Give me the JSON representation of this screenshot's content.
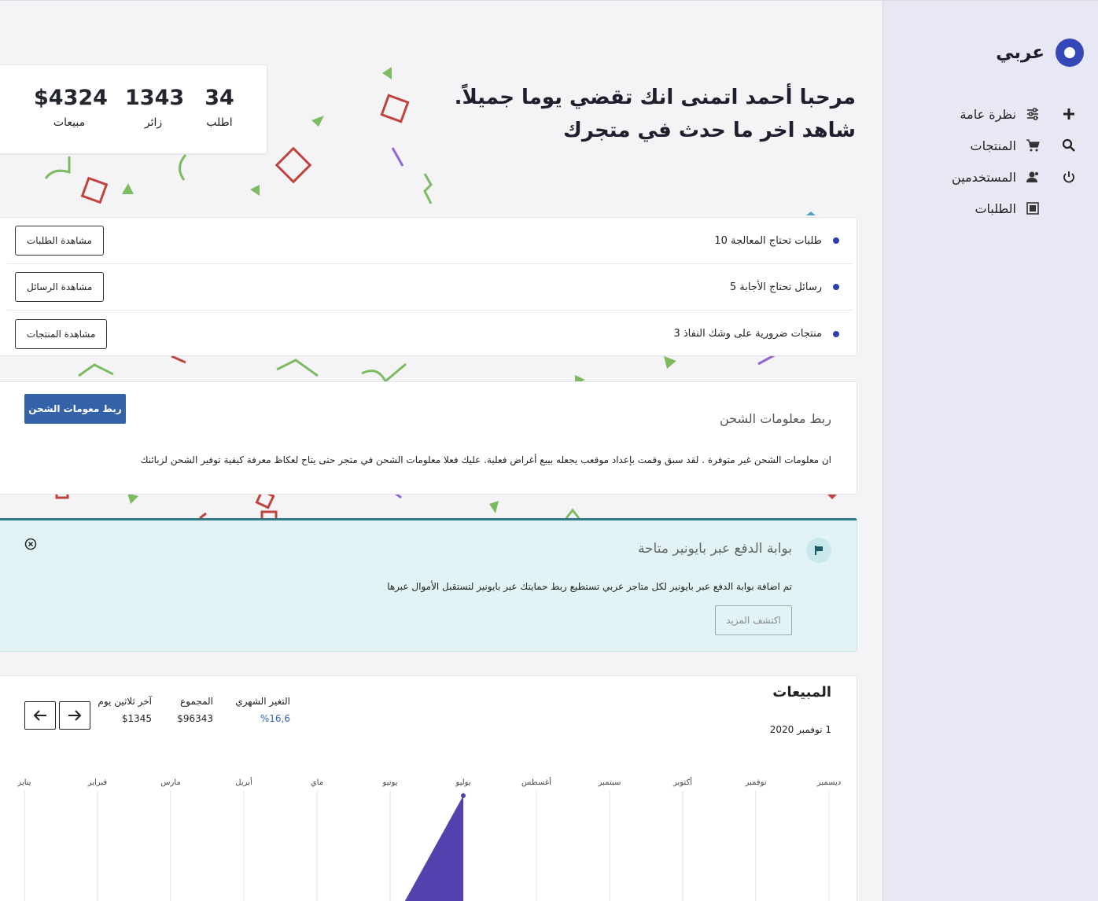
{
  "brand": {
    "name": "عربي"
  },
  "nav": {
    "items": [
      {
        "label": "نظرة عامة",
        "icon": "sliders-icon"
      },
      {
        "label": "المنتجات",
        "icon": "cart-icon"
      },
      {
        "label": "المستخدمين",
        "icon": "users-icon"
      },
      {
        "label": "الطلبات",
        "icon": "orders-icon"
      }
    ],
    "side_icons": [
      "plus-icon",
      "search-icon",
      "power-icon"
    ]
  },
  "hero": {
    "line1": "مرحبا أحمد اتمنى انك تقضي يوما جميلاً.",
    "line2": "شاهد اخر ما حدث في متجرك"
  },
  "stats": [
    {
      "value": "34",
      "label": "اطلب"
    },
    {
      "value": "1343",
      "label": "زائر"
    },
    {
      "value": "$4324",
      "label": "مبيعات"
    }
  ],
  "tasks": [
    {
      "text": "طلبات تحتاج المعالجة 10",
      "button": "مشاهدة الطلبات"
    },
    {
      "text": "رسائل تحتاج الأجابة 5",
      "button": "مشاهدة الرسائل"
    },
    {
      "text": "منتجات ضرورية على وشك النفاذ 3",
      "button": "مشاهدة المنتجات"
    }
  ],
  "shipping": {
    "title": "ربط معلومات الشحن",
    "description": "ان معلومات الشحن غير متوفرة . لقد سبق وقمت بإعداد موقعب يجعله بيبع أغراض فعلية. عليك فعلا معلومات الشحن في متجر حتى يتاح لعكاظ معرفة كيفية توفير الشحن لزبائنك",
    "button": "ربط معومات الشحن"
  },
  "payoneer": {
    "title": "بوابة الدفع عبر بايونير متاحة",
    "description": "تم اضافة بوابة الدفع عبر بايونير لكل متاجر عربي تستطيع ربط حمايتك عبر بايونير لتستقبل الأموال عبرها",
    "button": "اكتشف المزيد",
    "accent": "#317a8a"
  },
  "sales": {
    "title": "المبيعات",
    "date": "1 نوفمبر 2020",
    "metrics": [
      {
        "label": "التغير الشهري",
        "value": "%16,6",
        "highlight": true
      },
      {
        "label": "المجموع",
        "value": "$96343",
        "highlight": false
      },
      {
        "label": "آخر ثلاثين يوم",
        "value": "$1345",
        "highlight": false
      }
    ],
    "nav_icons": [
      "arrow-left-icon",
      "arrow-right-icon"
    ]
  },
  "chart_data": {
    "type": "area",
    "categories": [
      "يناير",
      "فبراير",
      "مارس",
      "أبريل",
      "ماي",
      "يونيو",
      "يوليو",
      "أغسطس",
      "سبتمبر",
      "أكتوبر",
      "نوفمبر",
      "ديسمبر"
    ],
    "series": [
      {
        "values": [
          0,
          0,
          0,
          0,
          0,
          0,
          100,
          null,
          null,
          null,
          null,
          null
        ],
        "color": "#5441ad"
      }
    ],
    "grid": true
  }
}
